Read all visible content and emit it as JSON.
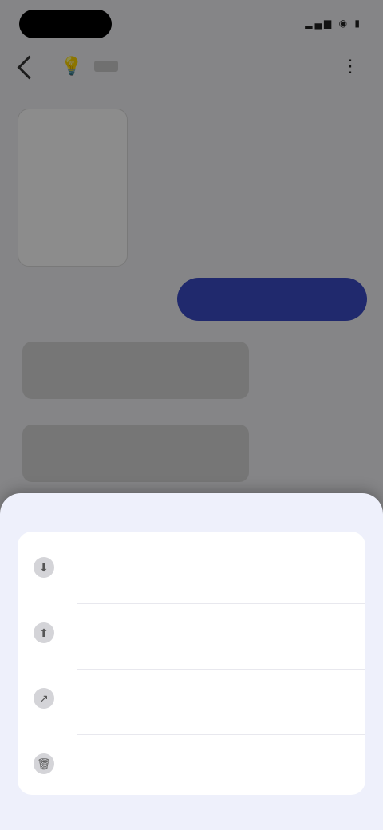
{
  "status_bar": {
    "time": "",
    "icons": "▂▄▆ ◉ ▮"
  },
  "toolbar": {
    "back_icon": "chevron-left-icon",
    "bulb_icon": "bulb-icon",
    "menu_icon": "more-icon"
  },
  "nav_menu": {
    "items": [
      {
        "label": ""
      },
      {
        "label": ""
      },
      {
        "label": ""
      },
      {
        "label": ""
      }
    ]
  },
  "side_caption": "",
  "cta_label": "",
  "content": {
    "right_label": ""
  },
  "sheet": {
    "title": "",
    "options": [
      {
        "icon": "download-icon",
        "title": "",
        "subtitle": ""
      },
      {
        "icon": "upload-icon",
        "title": "",
        "subtitle": ""
      },
      {
        "icon": "share-icon",
        "title": "",
        "subtitle": ""
      },
      {
        "icon": "delete-icon",
        "title": "",
        "subtitle": ""
      }
    ]
  },
  "colors": {
    "cta": "#3b4bc6",
    "sheet_bg": "#eef0fb"
  }
}
